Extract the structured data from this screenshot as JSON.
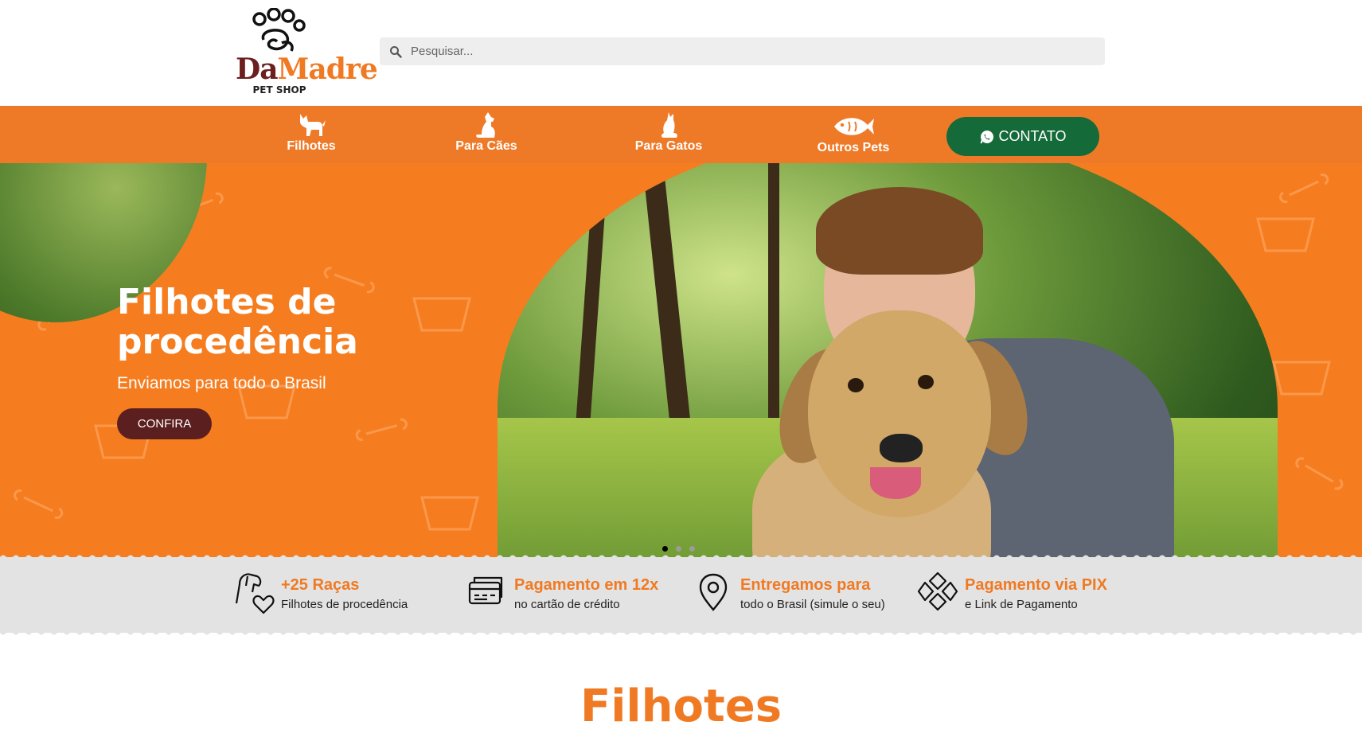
{
  "header": {
    "logo": {
      "part1": "Da",
      "part2": "Madre",
      "sub": "PET SHOP"
    },
    "search_placeholder": "Pesquisar..."
  },
  "nav": {
    "items": [
      {
        "label": "Filhotes",
        "icon": "puppy-icon"
      },
      {
        "label": "Para Cães",
        "icon": "dog-icon"
      },
      {
        "label": "Para Gatos",
        "icon": "cat-icon"
      },
      {
        "label": "Outros Pets",
        "icon": "fish-icon"
      }
    ],
    "contact_label": "CONTATO"
  },
  "hero": {
    "title": "Filhotes de procedência",
    "subtitle": "Enviamos para todo o Brasil",
    "button": "CONFIRA",
    "active_slide": 1,
    "slides": 3
  },
  "features": [
    {
      "title": "+25 Raças",
      "desc": "Filhotes de procedência",
      "icon": "dog-heart-icon"
    },
    {
      "title": "Pagamento em 12x",
      "desc": "no cartão de crédito",
      "icon": "credit-card-icon"
    },
    {
      "title": "Entregamos para",
      "desc": "todo o Brasil (simule o seu)",
      "icon": "location-pin-icon"
    },
    {
      "title": "Pagamento via PIX",
      "desc": "e Link de Pagamento",
      "icon": "pix-icon"
    }
  ],
  "section": {
    "title": "Filhotes"
  },
  "colors": {
    "orange": "#f57d20",
    "brown": "#5b1f1f",
    "green": "#156a3a",
    "gray": "#e3e3e3"
  }
}
